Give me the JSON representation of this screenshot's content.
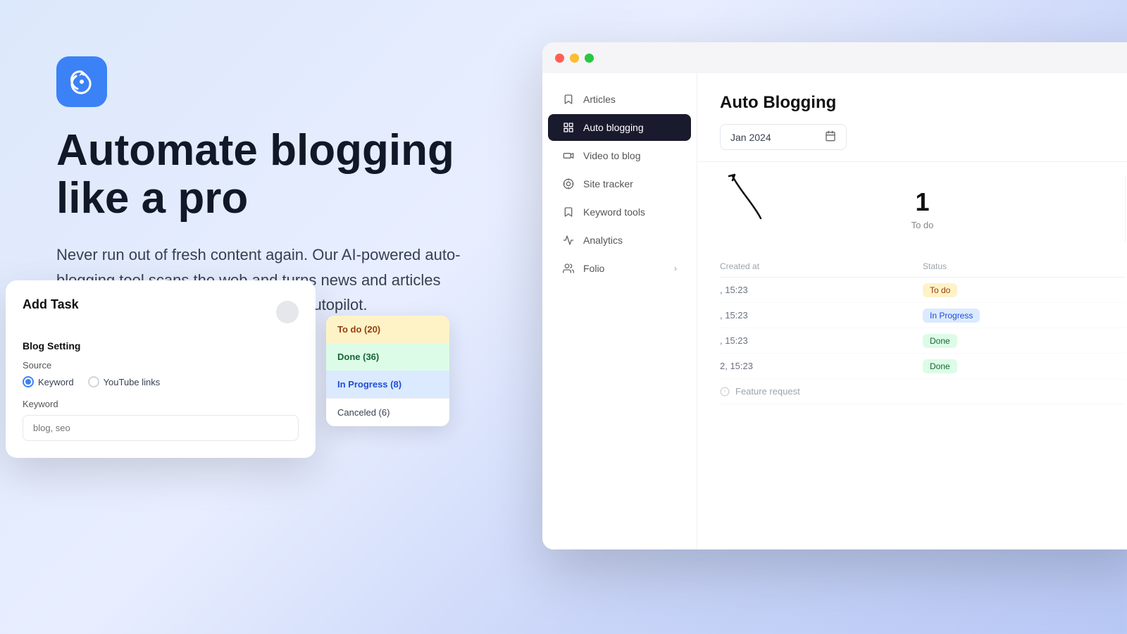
{
  "app": {
    "logo_alt": "App Logo"
  },
  "left": {
    "headline_line1": "Automate blogging",
    "headline_line2": "like a pro",
    "subtext": "Never run out of fresh content again. Our AI-powered auto-blogging tool scans the web and turns news and articles into optimized blog posts for you on autopilot."
  },
  "browser": {
    "traffic_buttons": [
      "red",
      "yellow",
      "green"
    ]
  },
  "sidebar": {
    "items": [
      {
        "id": "articles",
        "label": "Articles",
        "icon": "bookmark-icon"
      },
      {
        "id": "auto-blogging",
        "label": "Auto blogging",
        "icon": "grid-icon",
        "active": true
      },
      {
        "id": "video-to-blog",
        "label": "Video to blog",
        "icon": "video-icon"
      },
      {
        "id": "site-tracker",
        "label": "Site tracker",
        "icon": "target-icon"
      },
      {
        "id": "keyword-tools",
        "label": "Keyword tools",
        "icon": "bookmark-icon"
      },
      {
        "id": "analytics",
        "label": "Analytics",
        "icon": "chart-icon"
      }
    ],
    "folio_label": "Folio",
    "folio_icon": "users-icon"
  },
  "main": {
    "title": "Auto Blogging",
    "date_value": "Jan 2024",
    "date_placeholder": "Jan 2024",
    "stats": [
      {
        "number": "1",
        "label": "To do"
      }
    ],
    "table": {
      "columns": [
        "Created at",
        "Status",
        ""
      ],
      "rows": [
        {
          "created_at": ", 15:23",
          "status": "To do",
          "status_type": "todo",
          "extra": ""
        },
        {
          "created_at": ", 15:23",
          "status": "In Progress",
          "status_type": "inprogress",
          "extra": ""
        },
        {
          "created_at": ", 15:23",
          "status": "Done",
          "status_type": "done",
          "extra": ""
        },
        {
          "created_at": "2, 15:23",
          "status": "Done",
          "status_type": "done",
          "extra": ""
        }
      ]
    }
  },
  "modal": {
    "title": "Add Task",
    "section_label": "Blog Setting",
    "source_label": "Source",
    "source_options": [
      {
        "id": "keyword",
        "label": "Keyword",
        "selected": true
      },
      {
        "id": "youtube",
        "label": "YouTube links",
        "selected": false
      }
    ],
    "keyword_label": "Keyword",
    "keyword_placeholder": "blog, seo",
    "last_row_label": "Feature request"
  },
  "status_dropdown": {
    "items": [
      {
        "label": "To do (20)",
        "type": "todo"
      },
      {
        "label": "Done (36)",
        "type": "done"
      },
      {
        "label": "In Progress (8)",
        "type": "inprogress"
      },
      {
        "label": "Canceled (6)",
        "type": "cancelled"
      }
    ]
  }
}
